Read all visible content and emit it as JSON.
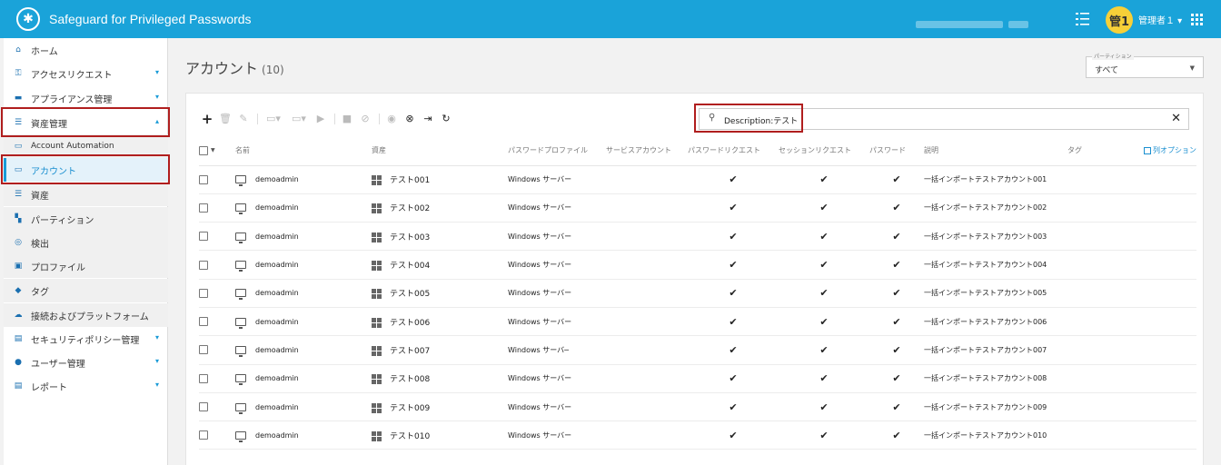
{
  "header": {
    "app_title": "Safeguard for Privileged Passwords",
    "avatar_text": "管1",
    "username": "管理者１ ▾"
  },
  "sidebar": {
    "items": [
      {
        "label": "ホーム",
        "icon": "home-icon"
      },
      {
        "label": "アクセスリクエスト",
        "icon": "key-icon"
      },
      {
        "label": "アプライアンス管理",
        "icon": "appliance-icon"
      },
      {
        "label": "資産管理",
        "icon": "list-icon"
      },
      {
        "label": "Account Automation",
        "icon": "monitor-icon"
      },
      {
        "label": "アカウント",
        "icon": "monitor-icon"
      },
      {
        "label": "資産",
        "icon": "list-icon"
      },
      {
        "label": "パーティション",
        "icon": "partition-icon"
      },
      {
        "label": "検出",
        "icon": "discovery-icon"
      },
      {
        "label": "プロファイル",
        "icon": "profile-icon"
      },
      {
        "label": "タグ",
        "icon": "tag-icon"
      },
      {
        "label": "接続およびプラットフォーム",
        "icon": "cloud-icon"
      },
      {
        "label": "セキュリティポリシー管理",
        "icon": "policy-icon"
      },
      {
        "label": "ユーザー管理",
        "icon": "user-icon"
      },
      {
        "label": "レポート",
        "icon": "report-icon"
      }
    ]
  },
  "main": {
    "title": "アカウント",
    "count": "(10)",
    "partition_label": "パーティション",
    "partition_value": "すべて",
    "search_value": "Description:テスト",
    "columns": {
      "name": "名前",
      "asset": "資産",
      "password_profile": "パスワードプロファイル",
      "service_account": "サービスアカウント",
      "password_request": "パスワードリクエスト",
      "session_request": "セッションリクエスト",
      "password": "パスワード",
      "description": "説明",
      "tag": "タグ",
      "column_options": "列オプション"
    },
    "rows": [
      {
        "name": "demoadmin",
        "asset": "テスト001",
        "profile": "Windows サーバー",
        "desc": "一括インポートテストアカウント001"
      },
      {
        "name": "demoadmin",
        "asset": "テスト002",
        "profile": "Windows サーバー",
        "desc": "一括インポートテストアカウント002"
      },
      {
        "name": "demoadmin",
        "asset": "テスト003",
        "profile": "Windows サーバー",
        "desc": "一括インポートテストアカウント003"
      },
      {
        "name": "demoadmin",
        "asset": "テスト004",
        "profile": "Windows サーバー",
        "desc": "一括インポートテストアカウント004"
      },
      {
        "name": "demoadmin",
        "asset": "テスト005",
        "profile": "Windows サーバー",
        "desc": "一括インポートテストアカウント005"
      },
      {
        "name": "demoadmin",
        "asset": "テスト006",
        "profile": "Windows サーバー",
        "desc": "一括インポートテストアカウント006"
      },
      {
        "name": "demoadmin",
        "asset": "テスト007",
        "profile": "Windows サーバ─",
        "desc": "一括インポートテストアカウント007"
      },
      {
        "name": "demoadmin",
        "asset": "テスト008",
        "profile": "Windows サーバー",
        "desc": "一括インポートテストアカウント008"
      },
      {
        "name": "demoadmin",
        "asset": "テスト009",
        "profile": "Windows サーバー",
        "desc": "一括インポートテストアカウント009"
      },
      {
        "name": "demoadmin",
        "asset": "テスト010",
        "profile": "Windows サーバー",
        "desc": "一括インポートテストアカウント010"
      }
    ]
  }
}
